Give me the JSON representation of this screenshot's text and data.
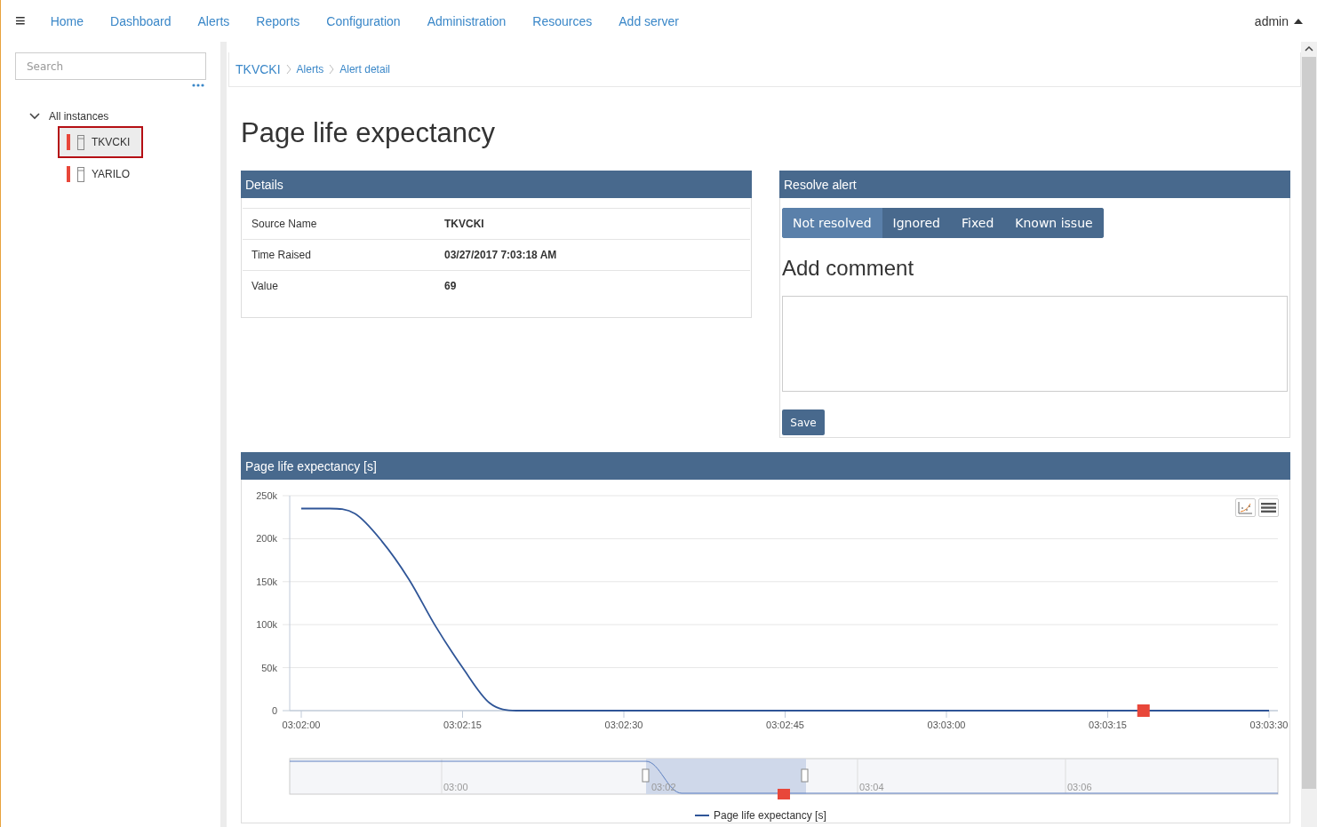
{
  "nav": {
    "menu_icon": "≡",
    "items": [
      "Home",
      "Dashboard",
      "Alerts",
      "Reports",
      "Configuration",
      "Administration",
      "Resources",
      "Add server"
    ],
    "user": "admin"
  },
  "sidebar": {
    "search": {
      "placeholder": "Search"
    },
    "tree": [
      {
        "label": "All instances",
        "expanded": true,
        "children": [
          {
            "label": "TKVCKI",
            "selected": true,
            "color": "#e8473a"
          },
          {
            "label": "YARILO",
            "selected": false,
            "color": "#e8473a"
          }
        ]
      }
    ]
  },
  "breadcrumb": [
    "TKVCKI",
    "Alerts",
    "Alert detail"
  ],
  "title": "Page life expectancy",
  "details": {
    "title": "Details",
    "rows": [
      {
        "label": "Source Name",
        "value": "TKVCKI"
      },
      {
        "label": "Time Raised",
        "value": "03/27/2017 7:03:18 AM"
      },
      {
        "label": "Value",
        "value": "69"
      }
    ]
  },
  "resolve": {
    "title": "Resolve alert",
    "options": [
      {
        "label": "Not resolved",
        "selected": true
      },
      {
        "label": "Ignored",
        "selected": false
      },
      {
        "label": "Fixed",
        "selected": false
      },
      {
        "label": "Known issue",
        "selected": false
      }
    ],
    "comment_heading": "Add comment",
    "save": "Save"
  },
  "chart_panel": {
    "title": "Page life expectancy [s]",
    "chart_data": {
      "type": "line",
      "grid": true,
      "categories": [
        "03:02:00",
        null,
        null,
        null,
        null,
        null,
        "03:02:15",
        null,
        null,
        null,
        null,
        null,
        "03:02:30",
        null,
        null,
        null,
        null,
        null,
        "03:02:45",
        null,
        null,
        null,
        null,
        null,
        "03:03:00",
        null,
        null,
        null,
        null,
        null,
        "03:03:15",
        null,
        null,
        null,
        null,
        null,
        "03:03:30"
      ],
      "series": [
        {
          "name": "Page life expectancy [s]",
          "color": "#2f5597",
          "values": [
            235000,
            235000,
            229000,
            197000,
            153000,
            98000,
            50000,
            9000,
            0,
            0,
            0,
            0,
            0,
            0,
            0,
            0,
            0,
            0,
            0,
            0,
            0,
            0,
            0,
            0,
            0,
            0,
            0,
            0,
            0,
            0,
            0,
            0,
            0,
            0,
            0,
            0,
            0
          ]
        }
      ],
      "ylim": [
        0,
        250000
      ],
      "yticks": [
        {
          "value": 0,
          "label": "0"
        },
        {
          "value": 50000,
          "label": "50k"
        },
        {
          "value": 100000,
          "label": "100k"
        },
        {
          "value": 150000,
          "label": "150k"
        },
        {
          "value": 200000,
          "label": "200k"
        },
        {
          "value": 250000,
          "label": "250k"
        }
      ]
    },
    "navigator_labels": [
      "03:00",
      "03:02",
      "03:04",
      "03:06"
    ]
  }
}
